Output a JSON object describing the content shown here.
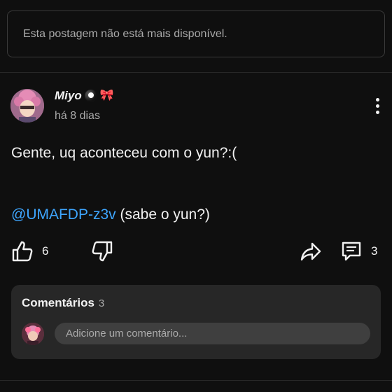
{
  "unavailable_notice": "Esta postagem não está mais disponível.",
  "post": {
    "author": "Miyo",
    "author_emojis": [
      "billiard-ball",
      "ribbon-bow"
    ],
    "timestamp": "há 8 dias",
    "text": "Gente, uq aconteceu com o yun?:(",
    "mention": "@UMAFDP-z3v",
    "mention_suffix": " (sabe o yun?)"
  },
  "actions": {
    "likes": "6",
    "comment_count": "3",
    "icons": [
      "thumbs-up-icon",
      "thumbs-down-icon",
      "share-icon",
      "comment-icon"
    ]
  },
  "comments": {
    "label": "Comentários",
    "count": "3",
    "placeholder": "Adicione um comentário..."
  },
  "colors": {
    "background": "#0f0f0f",
    "card": "#272727",
    "mention": "#3ea6ff",
    "muted_text": "#aaaaaa"
  }
}
